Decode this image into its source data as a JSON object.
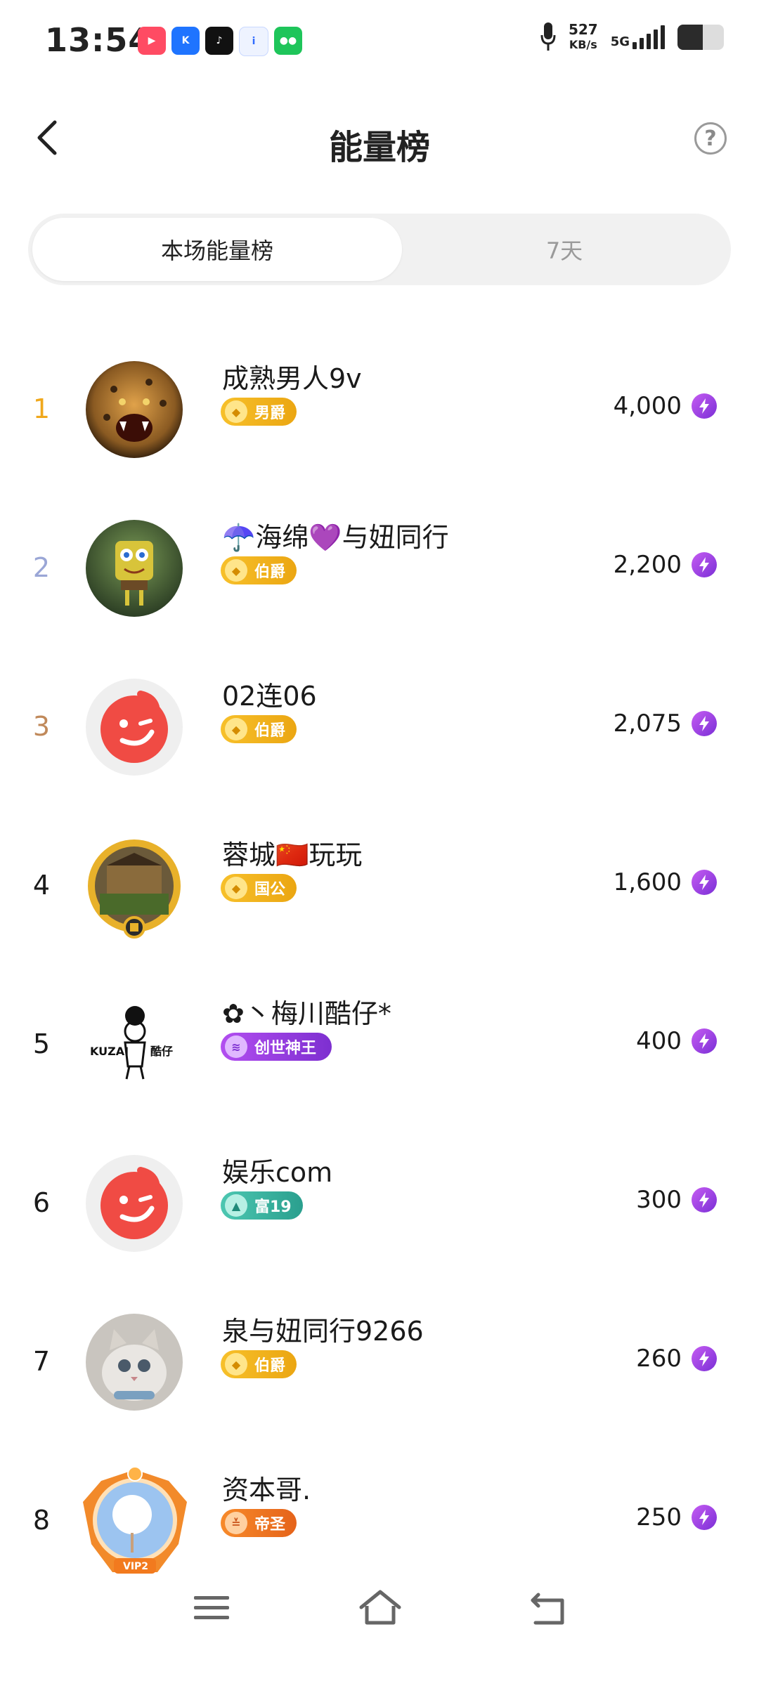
{
  "status_bar": {
    "time": "13:54",
    "speed_value": "527",
    "speed_unit": "KB/s",
    "network": "5G",
    "battery_level": 0.55,
    "app_icons": [
      "video-app-icon",
      "k-app-icon",
      "tiktok-icon",
      "ifly-icon",
      "wechat-icon"
    ]
  },
  "header": {
    "title": "能量榜",
    "help_icon": "help-circle-icon"
  },
  "tabs": [
    {
      "label": "本场能量榜",
      "active": true
    },
    {
      "label": "7天",
      "active": false
    }
  ],
  "ranking": [
    {
      "rank": "1",
      "name": "成熟男人9v",
      "badge": "男爵",
      "score": "4,000"
    },
    {
      "rank": "2",
      "name": "☂️海绵💜与妞同行",
      "badge": "伯爵",
      "score": "2,200"
    },
    {
      "rank": "3",
      "name": "02连06",
      "badge": "伯爵",
      "score": "2,075"
    },
    {
      "rank": "4",
      "name": "蓉城🇨🇳玩玩",
      "badge": "国公",
      "score": "1,600"
    },
    {
      "rank": "5",
      "name": "✿丶梅川酷仔*",
      "badge": "创世神王",
      "score": "400",
      "avatar_text": [
        "KUZAI",
        "酷仔"
      ]
    },
    {
      "rank": "6",
      "name": "娱乐com",
      "badge": "富19",
      "score": "300"
    },
    {
      "rank": "7",
      "name": "泉与妞同行9266",
      "badge": "伯爵",
      "score": "260"
    },
    {
      "rank": "8",
      "name": "资本哥.",
      "badge": "帝圣",
      "score": "250",
      "avatar_text": [
        "VIP2"
      ]
    }
  ],
  "colors": {
    "rank_gold": "#f0a81c",
    "rank_silver": "#9aa6d6",
    "rank_bronze": "#c0895a",
    "badge_gold": "#f3b418",
    "badge_purple": "#9a39e0",
    "badge_teal": "#3bb6a4",
    "badge_orange": "#f07a1e",
    "energy_purple": "#8a3de0"
  },
  "navbar": [
    "menu-icon",
    "home-icon",
    "back-nav-icon"
  ]
}
